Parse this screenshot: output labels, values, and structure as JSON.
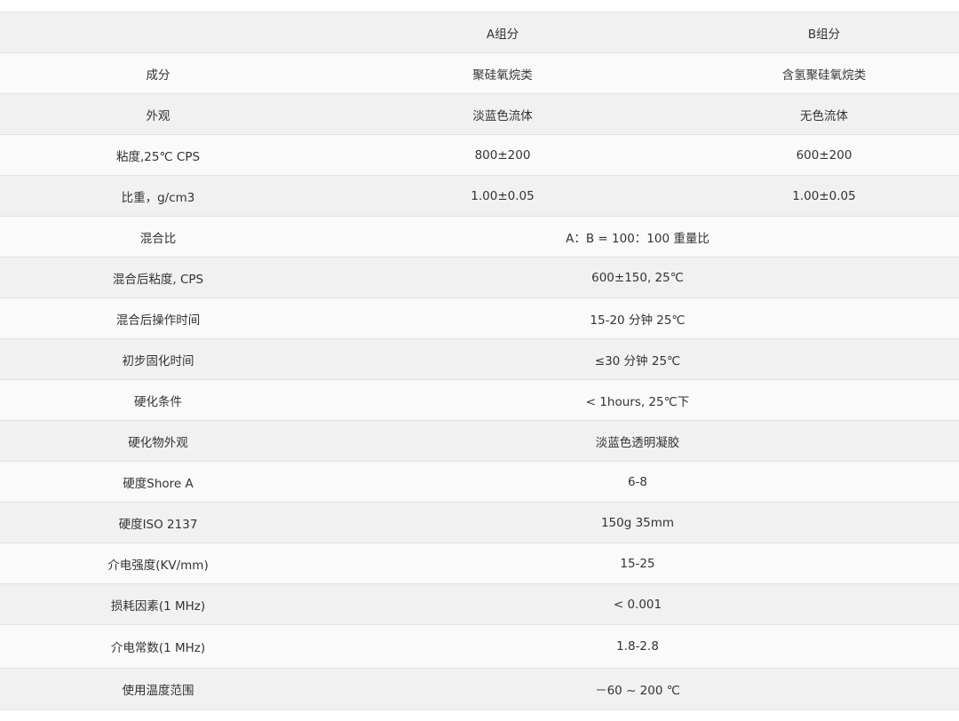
{
  "table": {
    "header": {
      "label": "",
      "component_a": "A组分",
      "component_b": "B组分"
    },
    "split_rows": [
      {
        "label": "成分",
        "a": "聚硅氧烷类",
        "b": "含氢聚硅氧烷类"
      },
      {
        "label": "外观",
        "a": "淡蓝色流体",
        "b": "无色流体"
      },
      {
        "label": "粘度,25℃ CPS",
        "a": "800±200",
        "b": "600±200"
      },
      {
        "label": "比重，g/cm3",
        "a": "1.00±0.05",
        "b": "1.00±0.05"
      }
    ],
    "merged_rows": [
      {
        "label": "混合比",
        "value": "A：B = 100：100 重量比"
      },
      {
        "label": "混合后粘度, CPS",
        "value": "600±150, 25℃"
      },
      {
        "label": "混合后操作时间",
        "value": "15-20 分钟 25℃"
      },
      {
        "label": "初步固化时间",
        "value": "≤30 分钟 25℃"
      },
      {
        "label": "硬化条件",
        "value": "< 1hours, 25℃下"
      },
      {
        "label": "硬化物外观",
        "value": "淡蓝色透明凝胶"
      },
      {
        "label": "硬度Shore A",
        "value": "6-8"
      },
      {
        "label": "硬度ISO 2137",
        "value": "150g 35mm"
      },
      {
        "label": "介电强度(KV/mm)",
        "value": "15-25"
      },
      {
        "label": "损耗因素(1 MHz)",
        "value": "< 0.001"
      },
      {
        "label": "介电常数(1 MHz)",
        "value": "1.8-2.8"
      },
      {
        "label": "使用温度范围",
        "value": "－60 ~ 200 ℃"
      }
    ]
  }
}
